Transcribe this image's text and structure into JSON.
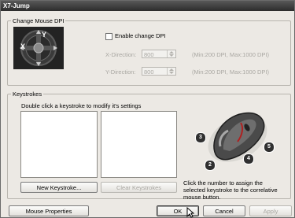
{
  "window": {
    "title": "X7-Jump"
  },
  "dpi_group": {
    "legend": "Change Mouse DPI",
    "joystick_labels": {
      "x": "X",
      "y": "Y"
    },
    "enable_label": "Enable change DPI",
    "enable_checked": false,
    "x_direction": {
      "label": "X-Direction:",
      "value": "800",
      "range": "(Min:200 DPI, Max:1000 DPI)"
    },
    "y_direction": {
      "label": "Y-Direction:",
      "value": "800",
      "range": "(Min:200 DPI, Max:1000 DPI)"
    }
  },
  "keystrokes_group": {
    "legend": "Keystrokes",
    "hint": "Double click a keystroke to modify it's settings",
    "new_button": "New Keystroke...",
    "clear_button": "Clear Keystrokes",
    "mouse_button_numbers": [
      "3",
      "4",
      "5",
      "2"
    ],
    "assign_hint": "Click the number to assign the selected keystroke to the correlative mouse button."
  },
  "footer": {
    "mouse_properties": "Mouse Properties",
    "ok": "OK",
    "cancel": "Cancel",
    "apply": "Apply"
  }
}
